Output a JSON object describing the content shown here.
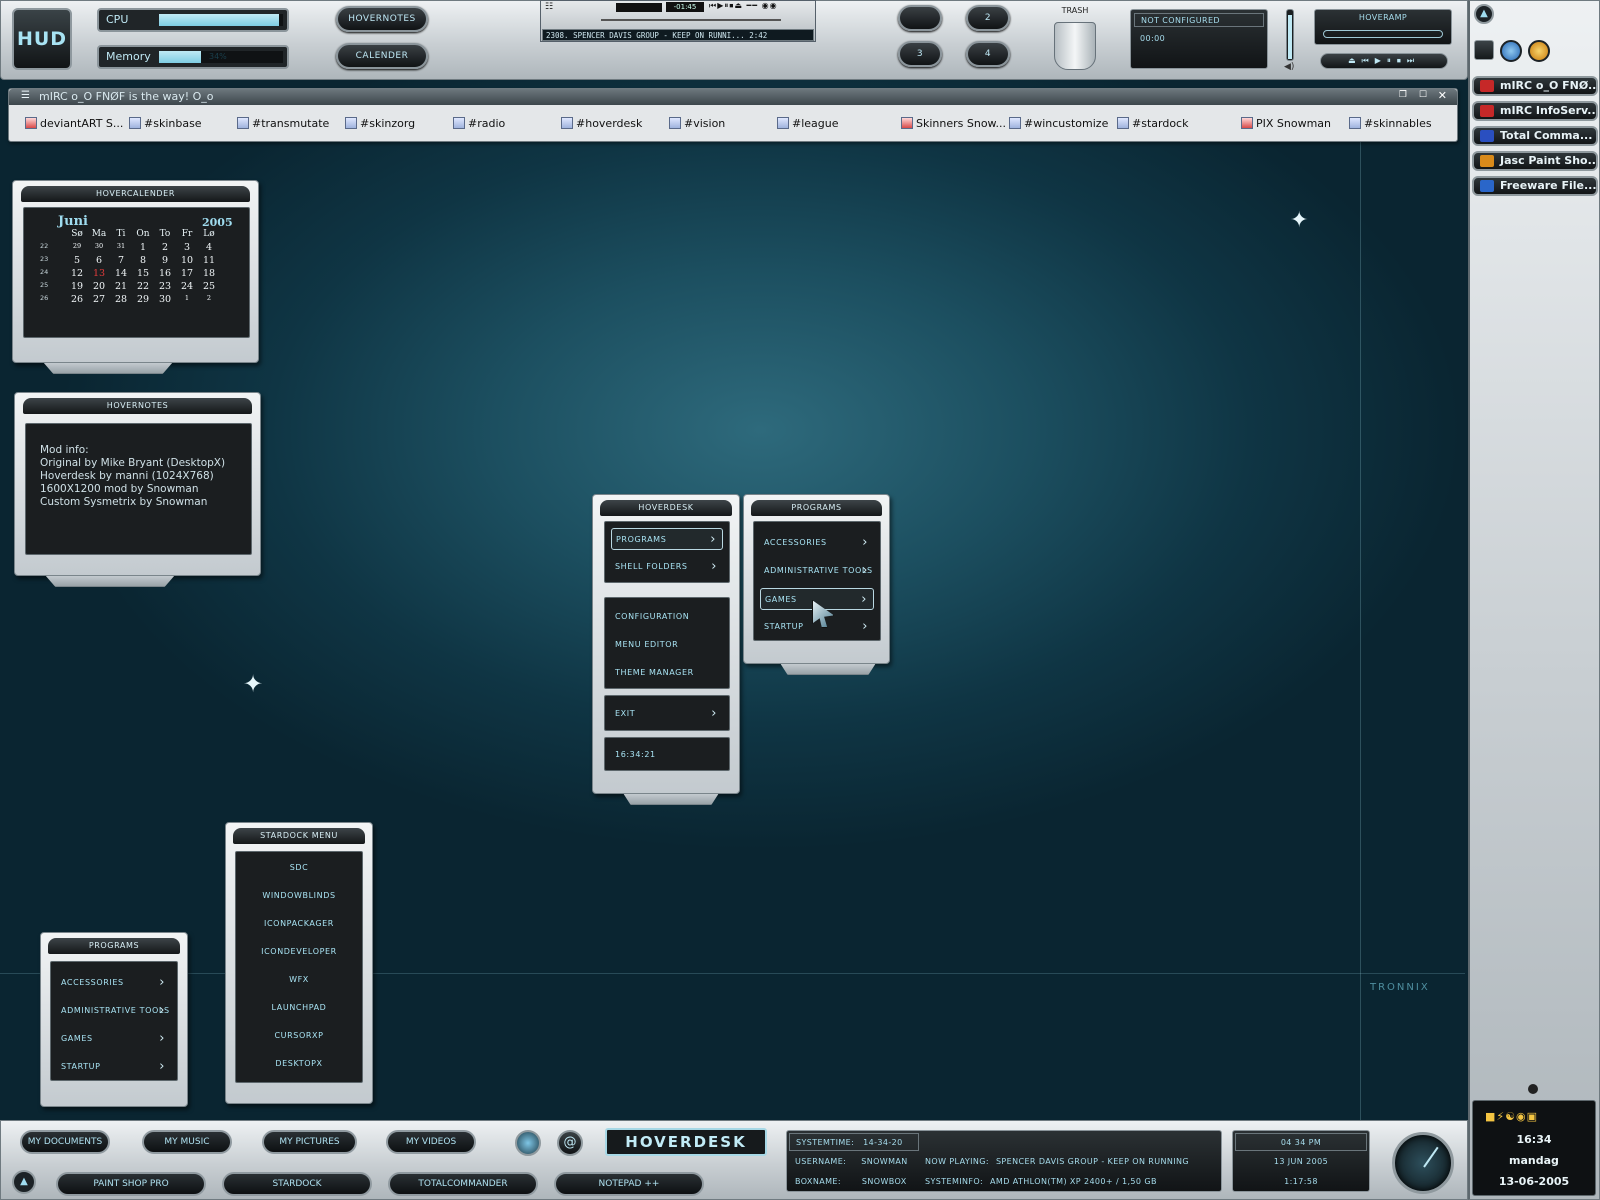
{
  "hud": {
    "logo": "HUD",
    "cpu_label": "CPU",
    "cpu_value": 0.97,
    "memory_label": "Memory",
    "memory_value": 0.34,
    "memory_text": "34%"
  },
  "top_buttons": {
    "hovernotes": "HOVERNOTES",
    "calendar": "CALENDER"
  },
  "player": {
    "time": "-01:45",
    "playlist_text": "2308. SPENCER DAVIS GROUP - KEEP ON RUNNI... 2:42"
  },
  "desk_buttons": {
    "d2": "2",
    "d3": "3",
    "d4": "4"
  },
  "trash": {
    "label": "TRASH"
  },
  "status_box": {
    "line1": "NOT CONFIGURED",
    "line2": "00:00"
  },
  "hoveramp": {
    "label": "HOVERAMP"
  },
  "mirc": {
    "title": "mIRC o_O FNØF is the way! O_o",
    "tabs": [
      {
        "label": "deviantART S...",
        "icon": "red"
      },
      {
        "label": "#skinbase",
        "icon": "blue"
      },
      {
        "label": "#transmutate",
        "icon": "blue"
      },
      {
        "label": "#skinzorg",
        "icon": "blue"
      },
      {
        "label": "#radio",
        "icon": "blue"
      },
      {
        "label": "#hoverdesk",
        "icon": "blue"
      },
      {
        "label": "#vision",
        "icon": "blue"
      },
      {
        "label": "#league",
        "icon": "blue"
      },
      {
        "label": "Skinners Snow...",
        "icon": "red"
      },
      {
        "label": "#wincustomize",
        "icon": "blue"
      },
      {
        "label": "#stardock",
        "icon": "blue"
      },
      {
        "label": "PIX Snowman",
        "icon": "red"
      },
      {
        "label": "#skinnables",
        "icon": "blue"
      }
    ]
  },
  "sidebar": {
    "items": [
      {
        "label": "mIRC o_O FNØ...",
        "color": "#c62828"
      },
      {
        "label": "mIRC InfoServ...",
        "color": "#c62828"
      },
      {
        "label": "Total Comma...",
        "color": "#2a4fc0"
      },
      {
        "label": "Jasc Paint Sho...",
        "color": "#d98a1a"
      },
      {
        "label": "Freeware File...",
        "color": "#2a66c9"
      }
    ],
    "clock": {
      "time": "16:34",
      "day": "mandag",
      "date": "13-06-2005"
    }
  },
  "calendar": {
    "title": "HOVERCALENDER",
    "month": "Juni",
    "year": "2005",
    "weekdays": [
      "Sø",
      "Ma",
      "Ti",
      "On",
      "To",
      "Fr",
      "Lø"
    ],
    "weeks": [
      {
        "wk": "22",
        "days": [
          "29",
          "30",
          "31",
          "1",
          "2",
          "3",
          "4"
        ],
        "dim": [
          true,
          true,
          true,
          false,
          false,
          false,
          false
        ]
      },
      {
        "wk": "23",
        "days": [
          "5",
          "6",
          "7",
          "8",
          "9",
          "10",
          "11"
        ],
        "dim": [
          false,
          false,
          false,
          false,
          false,
          false,
          false
        ]
      },
      {
        "wk": "24",
        "days": [
          "12",
          "13",
          "14",
          "15",
          "16",
          "17",
          "18"
        ],
        "dim": [
          false,
          false,
          false,
          false,
          false,
          false,
          false
        ],
        "today": 1
      },
      {
        "wk": "25",
        "days": [
          "19",
          "20",
          "21",
          "22",
          "23",
          "24",
          "25"
        ],
        "dim": [
          false,
          false,
          false,
          false,
          false,
          false,
          false
        ]
      },
      {
        "wk": "26",
        "days": [
          "26",
          "27",
          "28",
          "29",
          "30",
          "1",
          "2"
        ],
        "dim": [
          false,
          false,
          false,
          false,
          false,
          true,
          true
        ]
      }
    ]
  },
  "notes": {
    "title": "HOVERNOTES",
    "lines": [
      "Mod info:",
      "Original by Mike Bryant (DesktopX)",
      "Hoverdesk by manni (1024X768)",
      "1600X1200 mod by Snowman",
      "Custom Sysmetrix by Snowman"
    ]
  },
  "hoverdesk_menu": {
    "title": "HOVERDESK",
    "programs": "PROGRAMS",
    "shell": "SHELL FOLDERS",
    "config": "CONFIGURATION",
    "editor": "MENU EDITOR",
    "theme": "THEME MANAGER",
    "exit": "EXIT",
    "clock": "16:34:21"
  },
  "programs_menu": {
    "title": "PROGRAMS",
    "items": [
      "ACCESSORIES",
      "ADMINISTRATIVE TOOLS",
      "GAMES",
      "STARTUP"
    ]
  },
  "programs_small": {
    "title": "PROGRAMS",
    "items": [
      "ACCESSORIES",
      "ADMINISTRATIVE TOOLS",
      "GAMES",
      "STARTUP"
    ]
  },
  "stardock_menu": {
    "title": "STARDOCK MENU",
    "items": [
      "SDC",
      "WINDOWBLINDS",
      "ICONPACKAGER",
      "ICONDEVELOPER",
      "WFX",
      "LAUNCHPAD",
      "CURSORXP",
      "DESKTOPX"
    ]
  },
  "watermark": "TRONNIX",
  "bottom": {
    "docs": "MY DOCUMENTS",
    "music": "MY MUSIC",
    "pictures": "MY PICTURES",
    "videos": "MY VIDEOS",
    "logo": "HOVERDESK",
    "apps": [
      "PAINT SHOP PRO",
      "STARDOCK",
      "TOTALCOMMANDER",
      "NOTEPAD ++"
    ],
    "sys": {
      "systemtime_label": "SYSTEMTIME:",
      "systemtime": "14-34-20",
      "username_label": "USERNAME:",
      "username": "SNOWMAN",
      "boxname_label": "BOXNAME:",
      "boxname": "SNOWBOX",
      "nowplaying_label": "NOW PLAYING:",
      "nowplaying": "SPENCER DAVIS GROUP - KEEP ON RUNNING",
      "sysinfo_label": "SYSTEMINFO:",
      "sysinfo": "AMD ATHLON(TM) XP 2400+ / 1,50 GB"
    },
    "clock": {
      "time": "04 34 PM",
      "date": "13 JUN 2005",
      "uptime": "1:17:58"
    }
  }
}
